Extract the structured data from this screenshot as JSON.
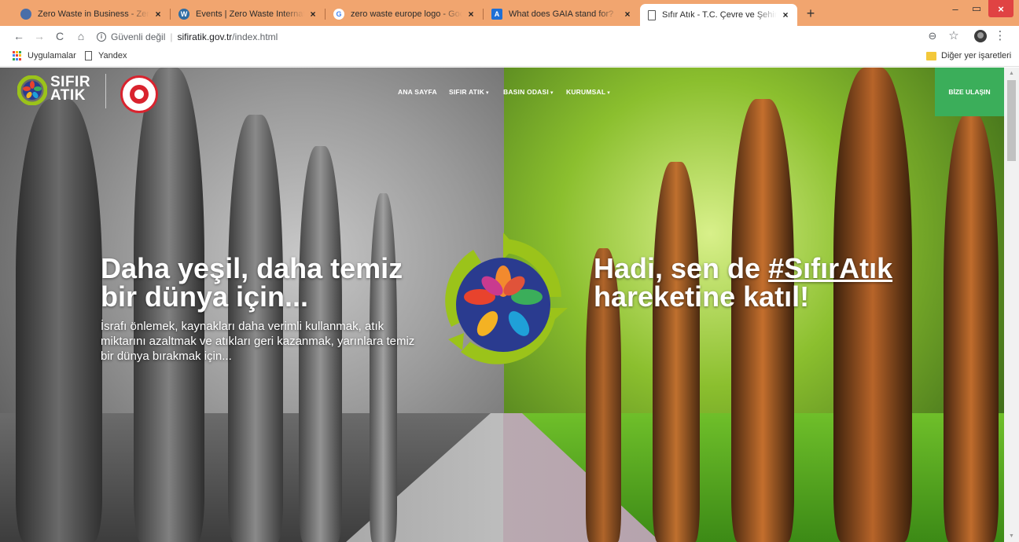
{
  "browser": {
    "tabs": [
      {
        "title": "Zero Waste in Business - Zero W",
        "favicon_color": "#3b6db5",
        "active": false
      },
      {
        "title": "Events | Zero Waste International",
        "favicon_color": "#2e6da4",
        "active": false
      },
      {
        "title": "zero waste europe logo - Google",
        "favicon_color": "#4285f4",
        "active": false
      },
      {
        "title": "What does GAIA stand for?",
        "favicon_color": "#1e6fd6",
        "active": false
      },
      {
        "title": "Sıfır Atık - T.C. Çevre ve Şehircilik",
        "favicon_color": "#ffffff",
        "active": true
      }
    ],
    "tab_close_glyph": "×",
    "new_tab_glyph": "+",
    "window_buttons": {
      "minimize": "–",
      "maximize": "▭",
      "close": "×"
    },
    "address": {
      "security_text": "Güvenli değil",
      "separator": "|",
      "host": "sifiratik.gov.tr",
      "path": "/index.html"
    },
    "nav_icons": {
      "back": "←",
      "forward": "→",
      "reload": "C",
      "home": "⌂",
      "zoom": "⊖",
      "star": "☆",
      "menu": "⋮"
    },
    "bookmarks": {
      "apps_label": "Uygulamalar",
      "items": [
        {
          "label": "Yandex"
        }
      ],
      "other_label": "Diğer yer işaretleri"
    }
  },
  "site": {
    "logo": {
      "line1": "SIFIR",
      "line2": "ATIK"
    },
    "nav": [
      {
        "label": "ANA SAYFA",
        "dropdown": false
      },
      {
        "label": "SIFIR ATIK",
        "dropdown": true
      },
      {
        "label": "BASIN ODASI",
        "dropdown": true
      },
      {
        "label": "KURUMSAL",
        "dropdown": true
      }
    ],
    "dropdown_caret": "▾",
    "contact_button": "BİZE ULAŞIN",
    "hero": {
      "left_title_line1": "Daha yeşil, daha temiz",
      "left_title_line2": "bir dünya için...",
      "left_body": "İsrafı önlemek, kaynakları daha verimli kullanmak, atık miktarını azaltmak ve atıkları geri kazanmak, yarınlara temiz bir dünya bırakmak için...",
      "right_title_prefix": "Hadi, sen de ",
      "right_hashtag": "#SıfırAtık",
      "right_title_line2": "hareketine katıl!"
    }
  },
  "colors": {
    "tabstrip": "#f1a56f",
    "contact_button": "#3bae5a",
    "logo_ring": "#9bc31a",
    "logo_disc": "#2a3b8f"
  }
}
